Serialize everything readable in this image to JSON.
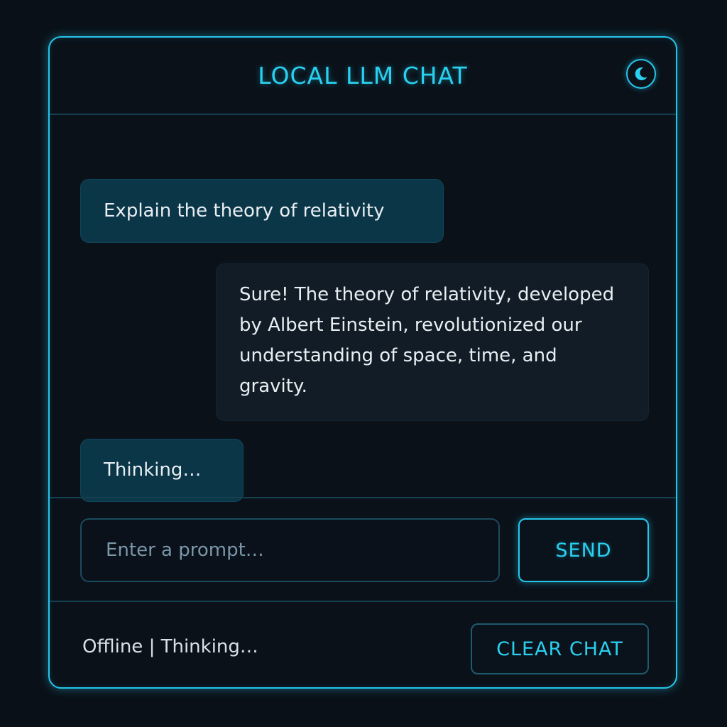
{
  "header": {
    "title": "LOCAL LLM CHAT",
    "theme_icon": "moon-icon"
  },
  "messages": [
    {
      "role": "user",
      "text": "Explain the theory of relativity"
    },
    {
      "role": "assistant",
      "text": "Sure! The theory of relativity, developed by Albert Einstein, revolutionized our understanding of space, time, and gravity."
    },
    {
      "role": "user",
      "text": "Thinking…"
    }
  ],
  "composer": {
    "placeholder": "Enter a prompt…",
    "value": "",
    "send_label": "SEND"
  },
  "footer": {
    "status": "Offline | Thinking…",
    "clear_label": "CLEAR CHAT"
  },
  "colors": {
    "accent": "#26c6ea",
    "background": "#0a1017",
    "user_bubble": "#0b3648",
    "assistant_bubble": "#111c26"
  }
}
